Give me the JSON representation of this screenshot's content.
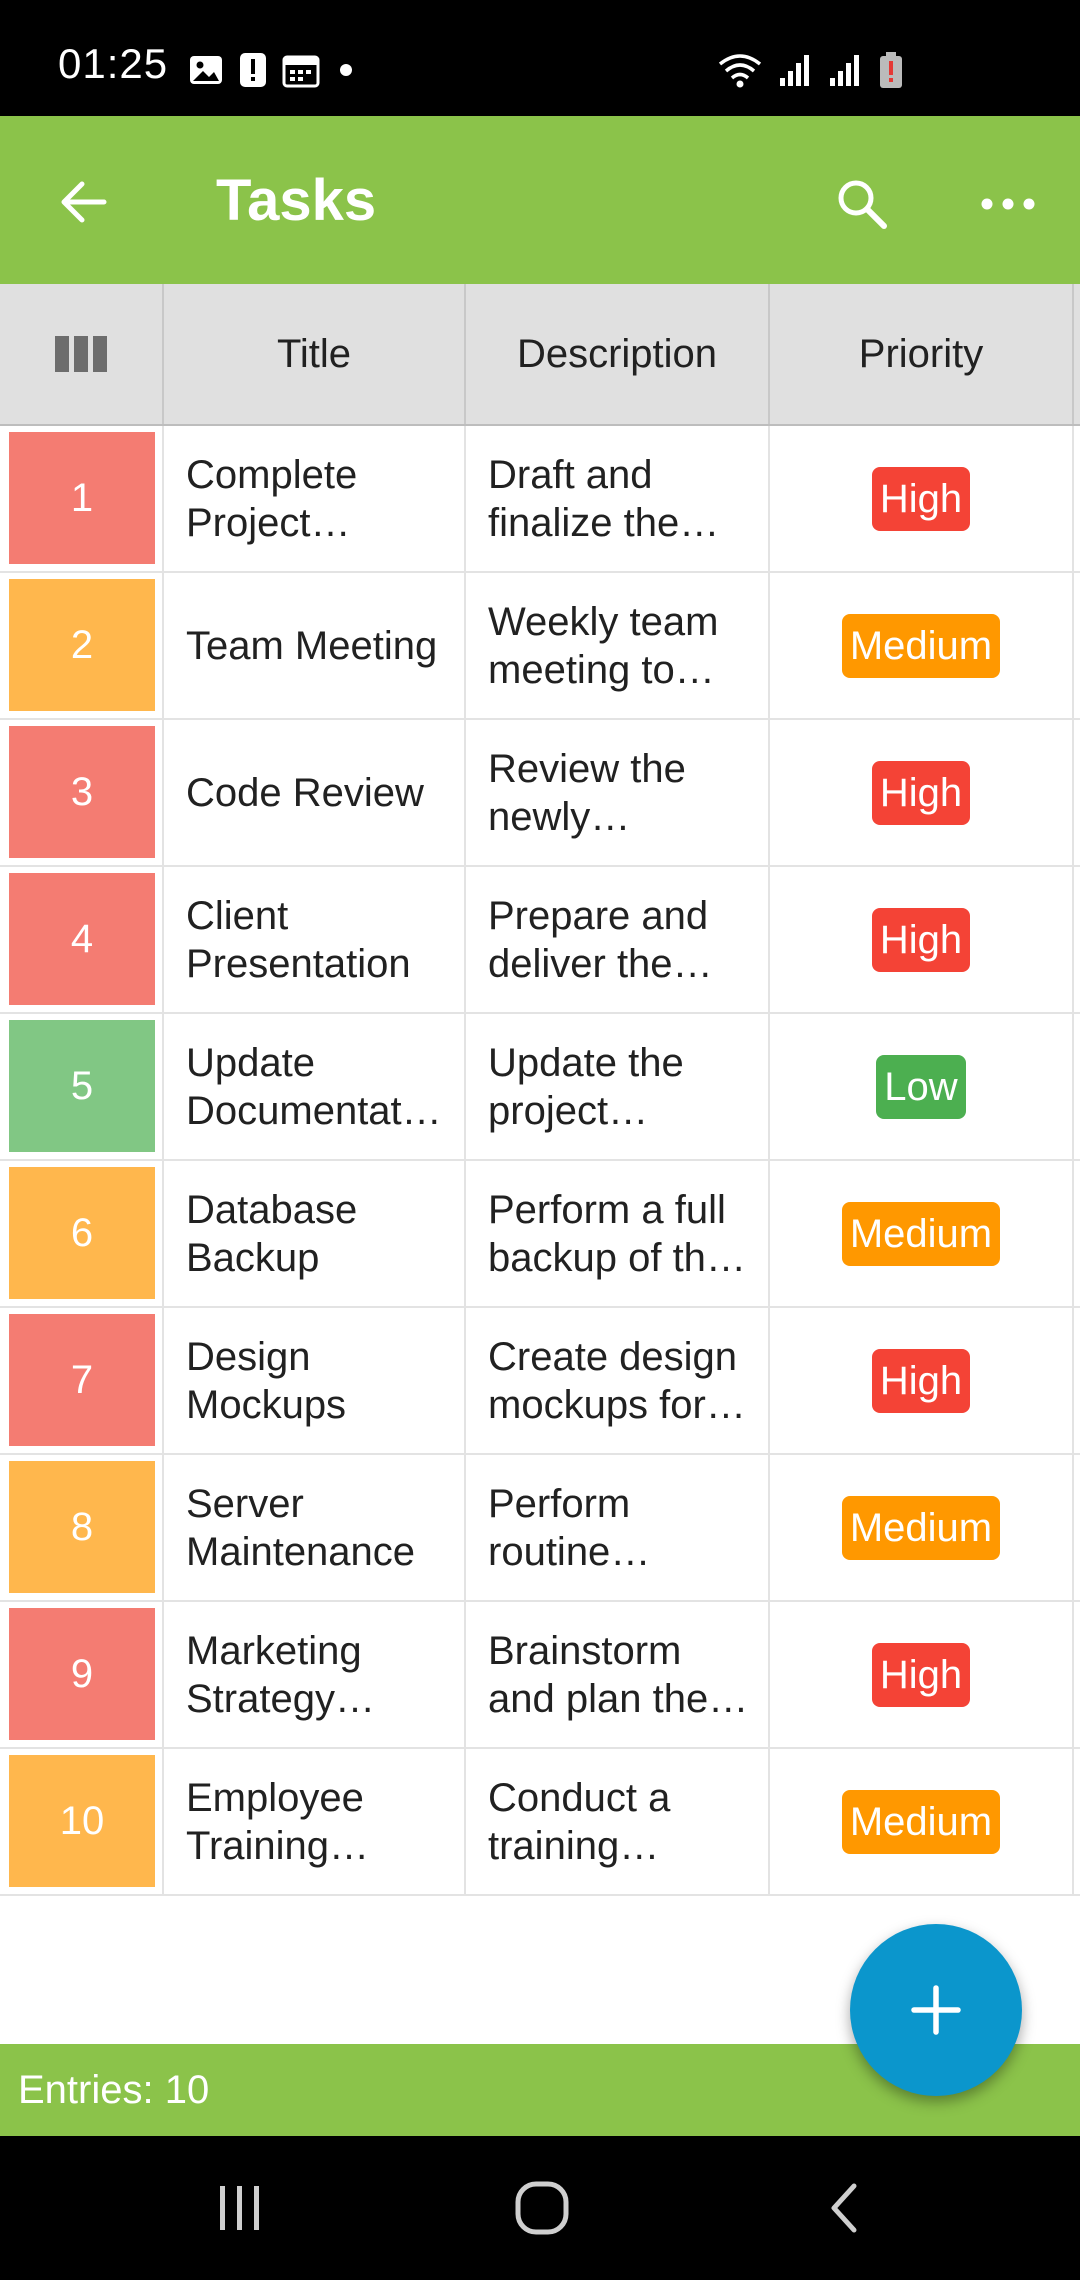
{
  "status_bar": {
    "time": "01:25",
    "left_icons": [
      "image-icon",
      "alert-icon",
      "calendar-icon",
      "dot-icon"
    ],
    "right_icons": [
      "wifi-icon",
      "signal-icon",
      "signal-icon",
      "battery-low-icon"
    ]
  },
  "app_bar": {
    "title": "Tasks",
    "back_icon": "arrow-left-icon",
    "search_icon": "search-icon",
    "more_icon": "more-horizontal-icon"
  },
  "table": {
    "columns_icon": "columns-icon",
    "headers": [
      "Title",
      "Description",
      "Priority"
    ],
    "rows": [
      {
        "index": "1",
        "title": "Complete Project Proposal",
        "description": "Draft and finalize the project proposal",
        "priority": "High",
        "color": "#f47c72"
      },
      {
        "index": "2",
        "title": "Team Meeting",
        "description": "Weekly team meeting to discuss progress",
        "priority": "Medium",
        "color": "#ffb74d"
      },
      {
        "index": "3",
        "title": "Code Review",
        "description": "Review the newly submitted code",
        "priority": "High",
        "color": "#f47c72"
      },
      {
        "index": "4",
        "title": "Client Presentation",
        "description": "Prepare and deliver the presentation",
        "priority": "High",
        "color": "#f47c72"
      },
      {
        "index": "5",
        "title": "Update Documentation",
        "description": "Update the project documentation",
        "priority": "Low",
        "color": "#81c784"
      },
      {
        "index": "6",
        "title": "Database Backup",
        "description": "Perform a full backup of the database",
        "priority": "Medium",
        "color": "#ffb74d"
      },
      {
        "index": "7",
        "title": "Design Mockups",
        "description": "Create design mockups for the app",
        "priority": "High",
        "color": "#f47c72"
      },
      {
        "index": "8",
        "title": "Server Maintenance",
        "description": "Perform routine maintenance",
        "priority": "Medium",
        "color": "#ffb74d"
      },
      {
        "index": "9",
        "title": "Marketing Strategy Meeting",
        "description": "Brainstorm and plan the strategy",
        "priority": "High",
        "color": "#f47c72"
      },
      {
        "index": "10",
        "title": "Employee Training Session",
        "description": "Conduct a training session",
        "priority": "Medium",
        "color": "#ffb74d"
      }
    ]
  },
  "priority_colors": {
    "High": "#f44336",
    "Medium": "#ff9800",
    "Low": "#4caf50"
  },
  "footer": {
    "entries_label": "Entries: 10"
  },
  "fab": {
    "icon": "plus-icon"
  },
  "nav_bar": {
    "icons": [
      "recent-apps-icon",
      "home-icon",
      "back-icon"
    ]
  }
}
